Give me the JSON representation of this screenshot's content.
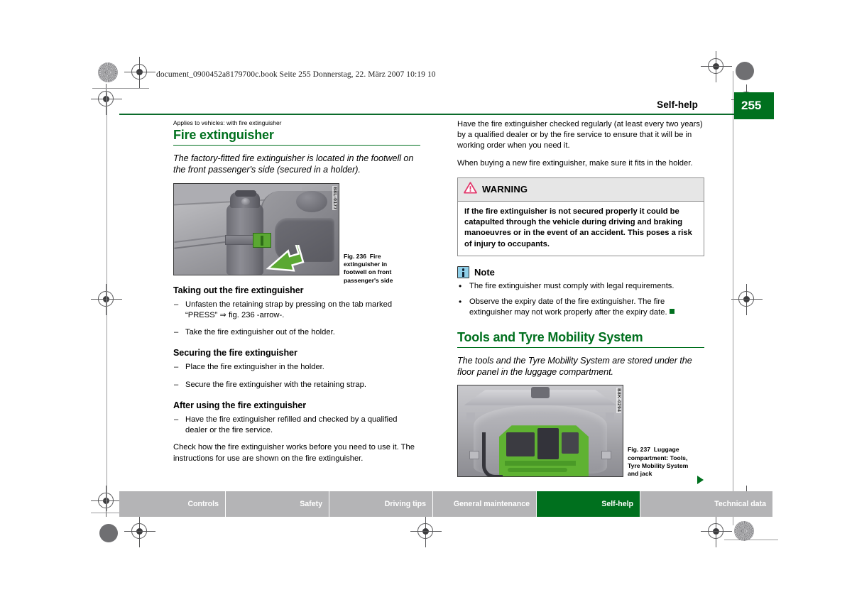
{
  "book_header": "document_0900452a8179700c.book  Seite 255  Donnerstag, 22. März 2007  10:19 10",
  "running_head": {
    "title": "Self-help",
    "page_number": "255"
  },
  "colors": {
    "green_accent": "#00701e",
    "footer_inactive": "#b4b4b6",
    "warning_head_bg": "#e6e6e6",
    "note_icon_bg": "#8fd0ea",
    "warning_triangle": "#e2376b"
  },
  "left_column": {
    "applies_to": "Applies to vehicles: with fire extinguisher",
    "section_title": "Fire extinguisher",
    "lead": "The factory-fitted fire extinguisher is located in the footwell on the front passenger's side (secured in a holder).",
    "figure": {
      "code": "B8L-0177",
      "caption_number": "Fig. 236",
      "caption_text": "Fire extinguisher in footwell on front passenger's side"
    },
    "sub1_title": "Taking out the fire extinguisher",
    "sub1_items": [
      "Unfasten the retaining strap by pressing on the tab marked “PRESS” ⇒ fig. 236  -arrow-.",
      "Take the fire extinguisher out of the holder."
    ],
    "sub2_title": "Securing the fire extinguisher",
    "sub2_items": [
      "Place the fire extinguisher in the holder.",
      "Secure the fire extinguisher with the retaining strap."
    ],
    "sub3_title": "After using the fire extinguisher",
    "sub3_items": [
      "Have the fire extinguisher refilled and checked by a qualified dealer or the fire service."
    ],
    "closing_paragraph": "Check how the fire extinguisher works before you need to use it. The instructions for use are shown on the fire extinguisher."
  },
  "right_column": {
    "paragraph1": "Have the fire extinguisher checked regularly (at least every two years) by a qualified dealer or by the fire service to ensure that it will be in working order when you need it.",
    "paragraph2": "When buying a new fire extinguisher, make sure it fits in the holder.",
    "warning": {
      "label": "WARNING",
      "text": "If the fire extinguisher is not secured properly it could be catapulted through the vehicle during driving and braking manoeuvres or in the event of an accident. This poses a risk of injury to occupants."
    },
    "note": {
      "label": "Note",
      "items": [
        "The fire extinguisher must comply with legal requirements.",
        "Observe the expiry date of the fire extinguisher. The fire extinguisher may not work properly after the expiry date."
      ]
    },
    "section_title": "Tools and Tyre Mobility System",
    "lead": "The tools and the Tyre Mobility System are stored under the floor panel in the luggage compartment.",
    "figure": {
      "code": "B8K-0294",
      "caption_number": "Fig. 237",
      "caption_text": "Luggage compartment: Tools, Tyre Mobility System and jack"
    }
  },
  "footer_tabs": [
    {
      "label": "Controls",
      "active": false
    },
    {
      "label": "Safety",
      "active": false
    },
    {
      "label": "Driving tips",
      "active": false
    },
    {
      "label": "General maintenance",
      "active": false
    },
    {
      "label": "Self-help",
      "active": true
    },
    {
      "label": "Technical data",
      "active": false
    }
  ]
}
